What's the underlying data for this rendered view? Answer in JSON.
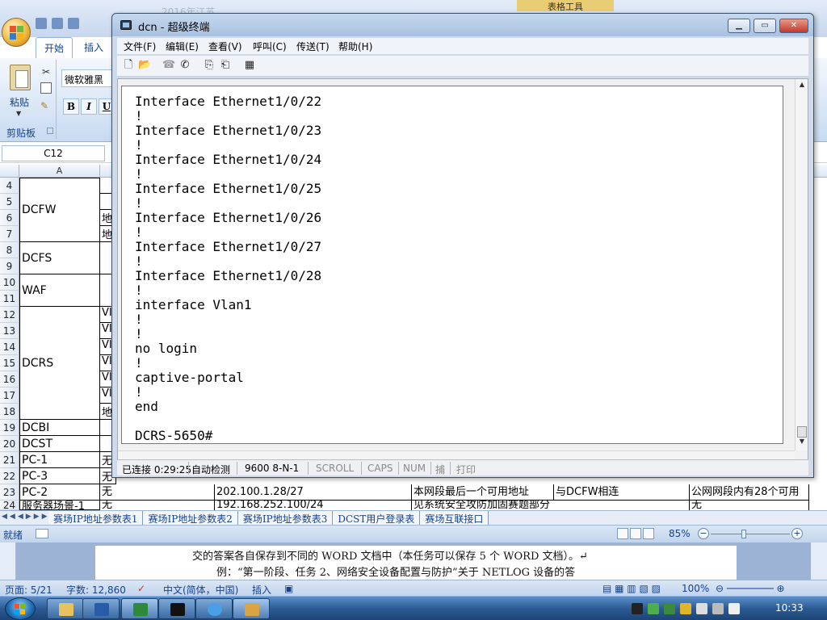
{
  "excel": {
    "title_faded": "2016年江苏...",
    "tools_label": "表格工具",
    "tabs": [
      "开始",
      "插入"
    ],
    "font_name": "微软雅黑",
    "font_buttons": [
      "B",
      "I",
      "U"
    ],
    "paste_label": "粘贴",
    "clipboard_label": "剪贴板",
    "namebox": "C12",
    "col_a": "A",
    "rows": [
      {
        "num": "4"
      },
      {
        "num": "5"
      },
      {
        "num": "6"
      },
      {
        "num": "7"
      },
      {
        "num": "8"
      },
      {
        "num": "9"
      },
      {
        "num": "10"
      },
      {
        "num": "11"
      },
      {
        "num": "12"
      },
      {
        "num": "13"
      },
      {
        "num": "14"
      },
      {
        "num": "15"
      },
      {
        "num": "16"
      },
      {
        "num": "17"
      },
      {
        "num": "18"
      },
      {
        "num": "19"
      },
      {
        "num": "20"
      },
      {
        "num": "21"
      },
      {
        "num": "22"
      },
      {
        "num": "23"
      },
      {
        "num": "24"
      }
    ],
    "groups": {
      "dcfw": "DCFW",
      "dcfs": "DCFS",
      "waf": "WAF",
      "dcrs": "DCRS",
      "dcbi": "DCBI",
      "dcst": "DCST",
      "pc1": "PC-1",
      "pc3": "PC-3",
      "pc2": "PC-2",
      "server": "服务器场景-1"
    },
    "colB": {
      "r6": "地",
      "r7": "地",
      "r12": "VI",
      "r13": "VI",
      "r14": "VI",
      "r15": "VI",
      "r16": "VI",
      "r17": "VI",
      "r18": "地",
      "r21": "无",
      "r22": "无",
      "r24": "无"
    },
    "row23": {
      "b": "无",
      "c": "202.100.1.28/27",
      "d": "本网段最后一个可用地址",
      "e": "与DCFW相连",
      "f": "公网网段内有28个可用"
    },
    "row24": {
      "c": "192.168.252.100/24",
      "d": "见系统安全攻防加固赛题部分",
      "f": "无"
    },
    "sheet_tabs": [
      "赛场IP地址参数表1",
      "赛场IP地址参数表2",
      "赛场IP地址参数表3",
      "DCST用户登录表",
      "赛场互联接口"
    ],
    "status_ready": "就绪",
    "zoom": "85%"
  },
  "terminal": {
    "window_title": "dcn - 超级终端",
    "menus": [
      "文件(F)",
      "编辑(E)",
      "查看(V)",
      "呼叫(C)",
      "传送(T)",
      "帮助(H)"
    ],
    "lines": [
      "Interface Ethernet1/0/22",
      "!",
      "Interface Ethernet1/0/23",
      "!",
      "Interface Ethernet1/0/24",
      "!",
      "Interface Ethernet1/0/25",
      "!",
      "Interface Ethernet1/0/26",
      "!",
      "Interface Ethernet1/0/27",
      "!",
      "Interface Ethernet1/0/28",
      "!",
      "interface Vlan1",
      "!",
      "!",
      "no login",
      "!",
      "captive-portal",
      "!",
      "end",
      "",
      "DCRS-5650#"
    ],
    "status": {
      "connected": "已连接 0:29:25",
      "detect": "自动检测",
      "baud": "9600 8-N-1",
      "scroll": "SCROLL",
      "caps": "CAPS",
      "num": "NUM",
      "capture": "捕",
      "print": "打印"
    }
  },
  "word": {
    "line1": "交的答案各自保存到不同的 WORD 文档中（本任务可以保存 5 个 WORD 文档）。↵",
    "line2": "例：“第一阶段、任务 2、网络安全设备配置与防护”关于 NETLOG 设备的答",
    "page": "页面: 5/21",
    "words": "字数: 12,860",
    "lang": "中文(简体，中国)",
    "mode": "插入",
    "zoom": "100%"
  },
  "taskbar": {
    "clock": "10:33"
  }
}
